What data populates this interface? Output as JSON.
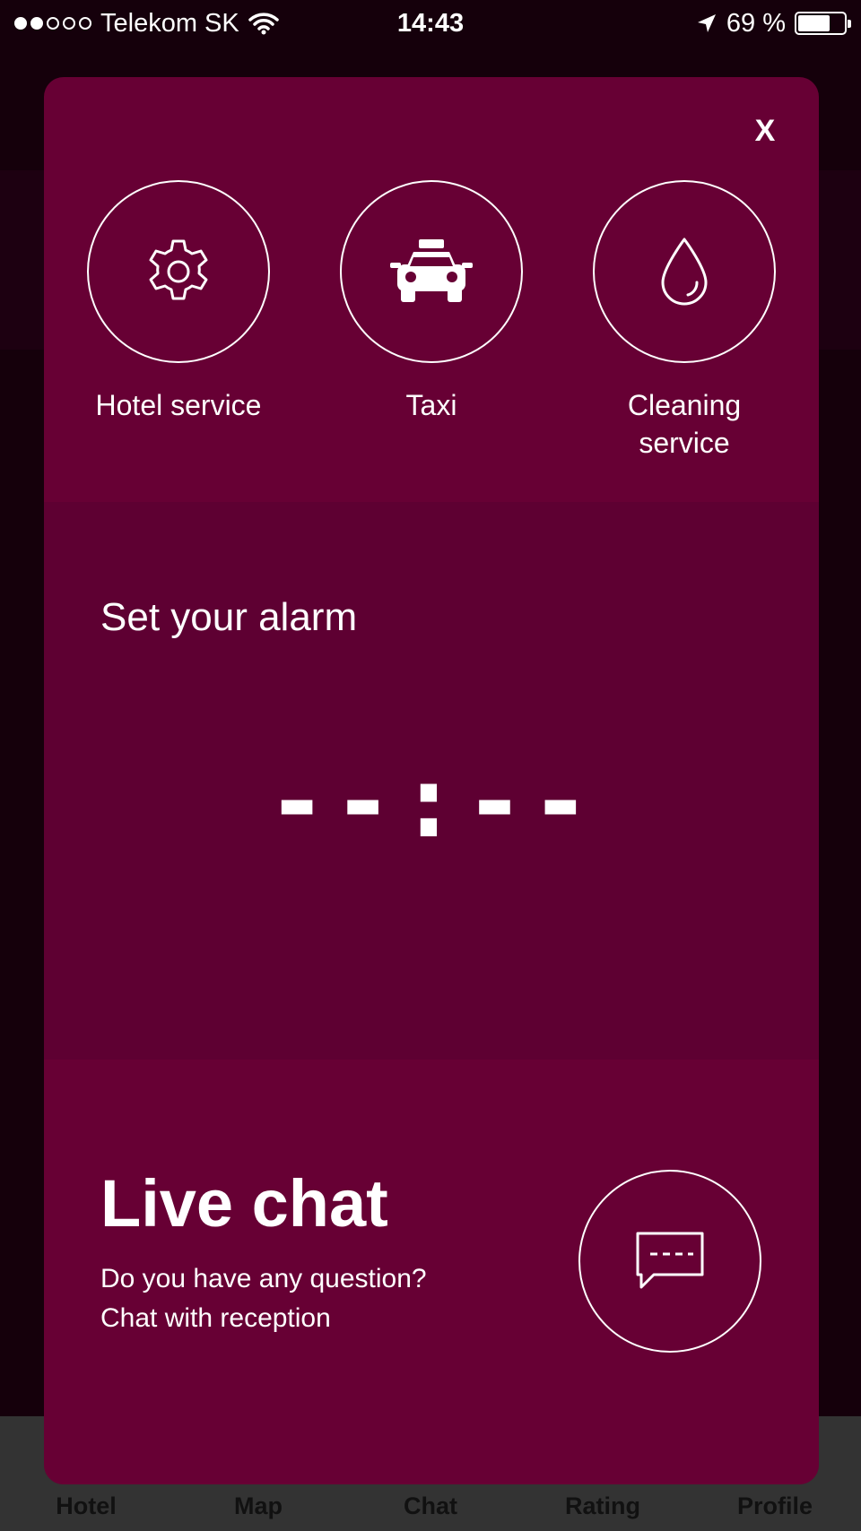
{
  "status_bar": {
    "carrier": "Telekom SK",
    "time": "14:43",
    "battery": "69 %",
    "battery_level": 0.69,
    "signal_bars_filled": 2,
    "signal_bars_total": 5,
    "icons": [
      "wifi-icon",
      "location-arrow-icon",
      "battery-icon"
    ]
  },
  "modal": {
    "close_label": "X",
    "services": [
      {
        "label": "Hotel service",
        "icon": "gear-icon"
      },
      {
        "label": "Taxi",
        "icon": "taxi-icon"
      },
      {
        "label": "Cleaning service",
        "icon": "droplet-icon"
      }
    ],
    "alarm": {
      "title": "Set your alarm",
      "time": "--:--"
    },
    "chat": {
      "title": "Live chat",
      "line1": "Do you have any question?",
      "line2": "Chat with reception",
      "icon": "chat-bubble-icon"
    }
  },
  "tab_bar": {
    "items": [
      "Hotel",
      "Map",
      "Chat",
      "Rating",
      "Profile"
    ]
  },
  "colors": {
    "modal_bg": "#670034",
    "alarm_bg": "#5e0032",
    "page_bg": "#15000b",
    "tab_bar_bg": "#333333"
  }
}
